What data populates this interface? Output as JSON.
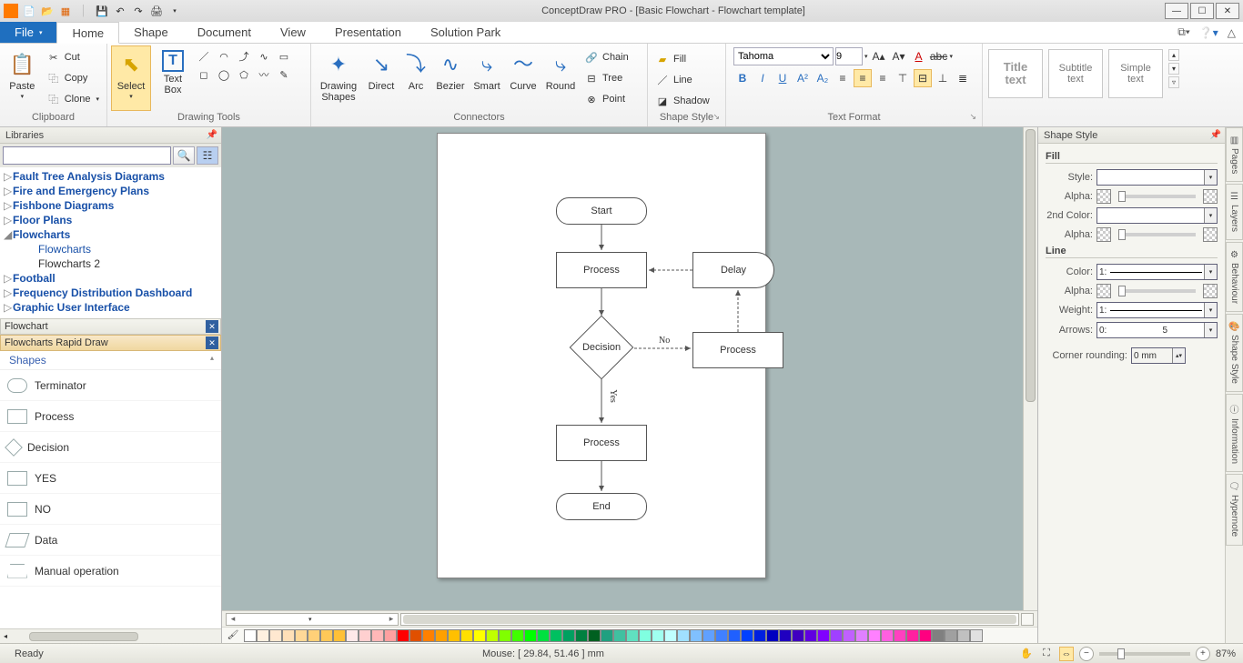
{
  "app": {
    "title": "ConceptDraw PRO - [Basic Flowchart - Flowchart template]"
  },
  "menu": {
    "file": "File",
    "tabs": [
      "Home",
      "Shape",
      "Document",
      "View",
      "Presentation",
      "Solution Park"
    ],
    "active": "Home"
  },
  "ribbon": {
    "clipboard": {
      "label": "Clipboard",
      "paste": "Paste",
      "cut": "Cut",
      "copy": "Copy",
      "clone": "Clone"
    },
    "drawingtools": {
      "label": "Drawing Tools",
      "select": "Select",
      "textbox": "Text\nBox",
      "drawingshapes": "Drawing\nShapes"
    },
    "connectors": {
      "label": "Connectors",
      "direct": "Direct",
      "arc": "Arc",
      "bezier": "Bezier",
      "smart": "Smart",
      "curve": "Curve",
      "round": "Round",
      "chain": "Chain",
      "tree": "Tree",
      "point": "Point"
    },
    "shapestyle": {
      "label": "Shape Style",
      "fill": "Fill",
      "line": "Line",
      "shadow": "Shadow"
    },
    "textformat": {
      "label": "Text Format",
      "font": "Tahoma",
      "size": "9"
    },
    "styles": {
      "title": "Title\ntext",
      "subtitle": "Subtitle\ntext",
      "simple": "Simple\ntext"
    }
  },
  "libraries": {
    "header": "Libraries",
    "tree": [
      {
        "t": "Fault Tree Analysis Diagrams",
        "exp": "▷"
      },
      {
        "t": "Fire and Emergency Plans",
        "exp": "▷"
      },
      {
        "t": "Fishbone Diagrams",
        "exp": "▷"
      },
      {
        "t": "Floor Plans",
        "exp": "▷"
      },
      {
        "t": "Flowcharts",
        "exp": "◣",
        "open": true
      },
      {
        "t": "Flowcharts",
        "sub": true
      },
      {
        "t": "Flowcharts 2",
        "sub": true,
        "black": true
      },
      {
        "t": "Football",
        "exp": "▷"
      },
      {
        "t": "Frequency Distribution Dashboard",
        "exp": "▷"
      },
      {
        "t": "Graphic User Interface",
        "exp": "▷"
      }
    ],
    "stencils": [
      {
        "t": "Flowchart"
      },
      {
        "t": "Flowcharts Rapid Draw",
        "active": true
      }
    ],
    "shapesHeader": "Shapes",
    "shapes": [
      {
        "t": "Terminator",
        "k": "term"
      },
      {
        "t": "Process",
        "k": "proc"
      },
      {
        "t": "Decision",
        "k": "dec"
      },
      {
        "t": "YES",
        "k": "proc"
      },
      {
        "t": "NO",
        "k": "proc"
      },
      {
        "t": "Data",
        "k": "para"
      },
      {
        "t": "Manual operation",
        "k": "trap"
      }
    ]
  },
  "canvas": {
    "shapes": {
      "start": "Start",
      "process": "Process",
      "delay": "Delay",
      "decision": "Decision",
      "end": "End"
    },
    "labels": {
      "no": "No",
      "yes": "Yes"
    }
  },
  "rightpanel": {
    "header": "Shape Style",
    "fill": "Fill",
    "line": "Line",
    "style": "Style:",
    "alpha": "Alpha:",
    "color2": "2nd Color:",
    "color": "Color:",
    "weight": "Weight:",
    "arrows": "Arrows:",
    "rounding": "Corner rounding:",
    "roundingVal": "0 mm",
    "weightVal": "1:",
    "colorVal": "1:",
    "arrowVal": "0:                      5",
    "tabs": [
      "Pages",
      "Layers",
      "Behaviour",
      "Shape Style",
      "Information",
      "Hypernote"
    ]
  },
  "status": {
    "ready": "Ready",
    "mouse": "Mouse: [ 29.84, 51.46 ] mm",
    "zoom": "87%"
  },
  "colorbar": [
    "#ffffff",
    "#fff0e0",
    "#ffe8d0",
    "#ffe0b8",
    "#ffd898",
    "#ffd078",
    "#ffc858",
    "#ffc038",
    "#ffe8e8",
    "#ffd0d0",
    "#ffb8b8",
    "#ffa0a0",
    "#ff0000",
    "#e05000",
    "#ff8000",
    "#ffa000",
    "#ffc000",
    "#ffe000",
    "#ffff00",
    "#c0ff00",
    "#80ff00",
    "#40ff00",
    "#00ff00",
    "#00e040",
    "#00c060",
    "#00a060",
    "#008040",
    "#006020",
    "#20a080",
    "#40c0a0",
    "#60e0c0",
    "#80ffe0",
    "#a0fff0",
    "#c0ffff",
    "#a0e0ff",
    "#80c0ff",
    "#60a0ff",
    "#4080ff",
    "#2060ff",
    "#0040ff",
    "#0020e0",
    "#0000c0",
    "#2000c0",
    "#4000c0",
    "#6000e0",
    "#8000ff",
    "#a040ff",
    "#c060ff",
    "#e080ff",
    "#ff80ff",
    "#ff60e0",
    "#ff40c0",
    "#ff20a0",
    "#ff0080",
    "#808080",
    "#a0a0a0",
    "#c0c0c0",
    "#e0e0e0"
  ]
}
